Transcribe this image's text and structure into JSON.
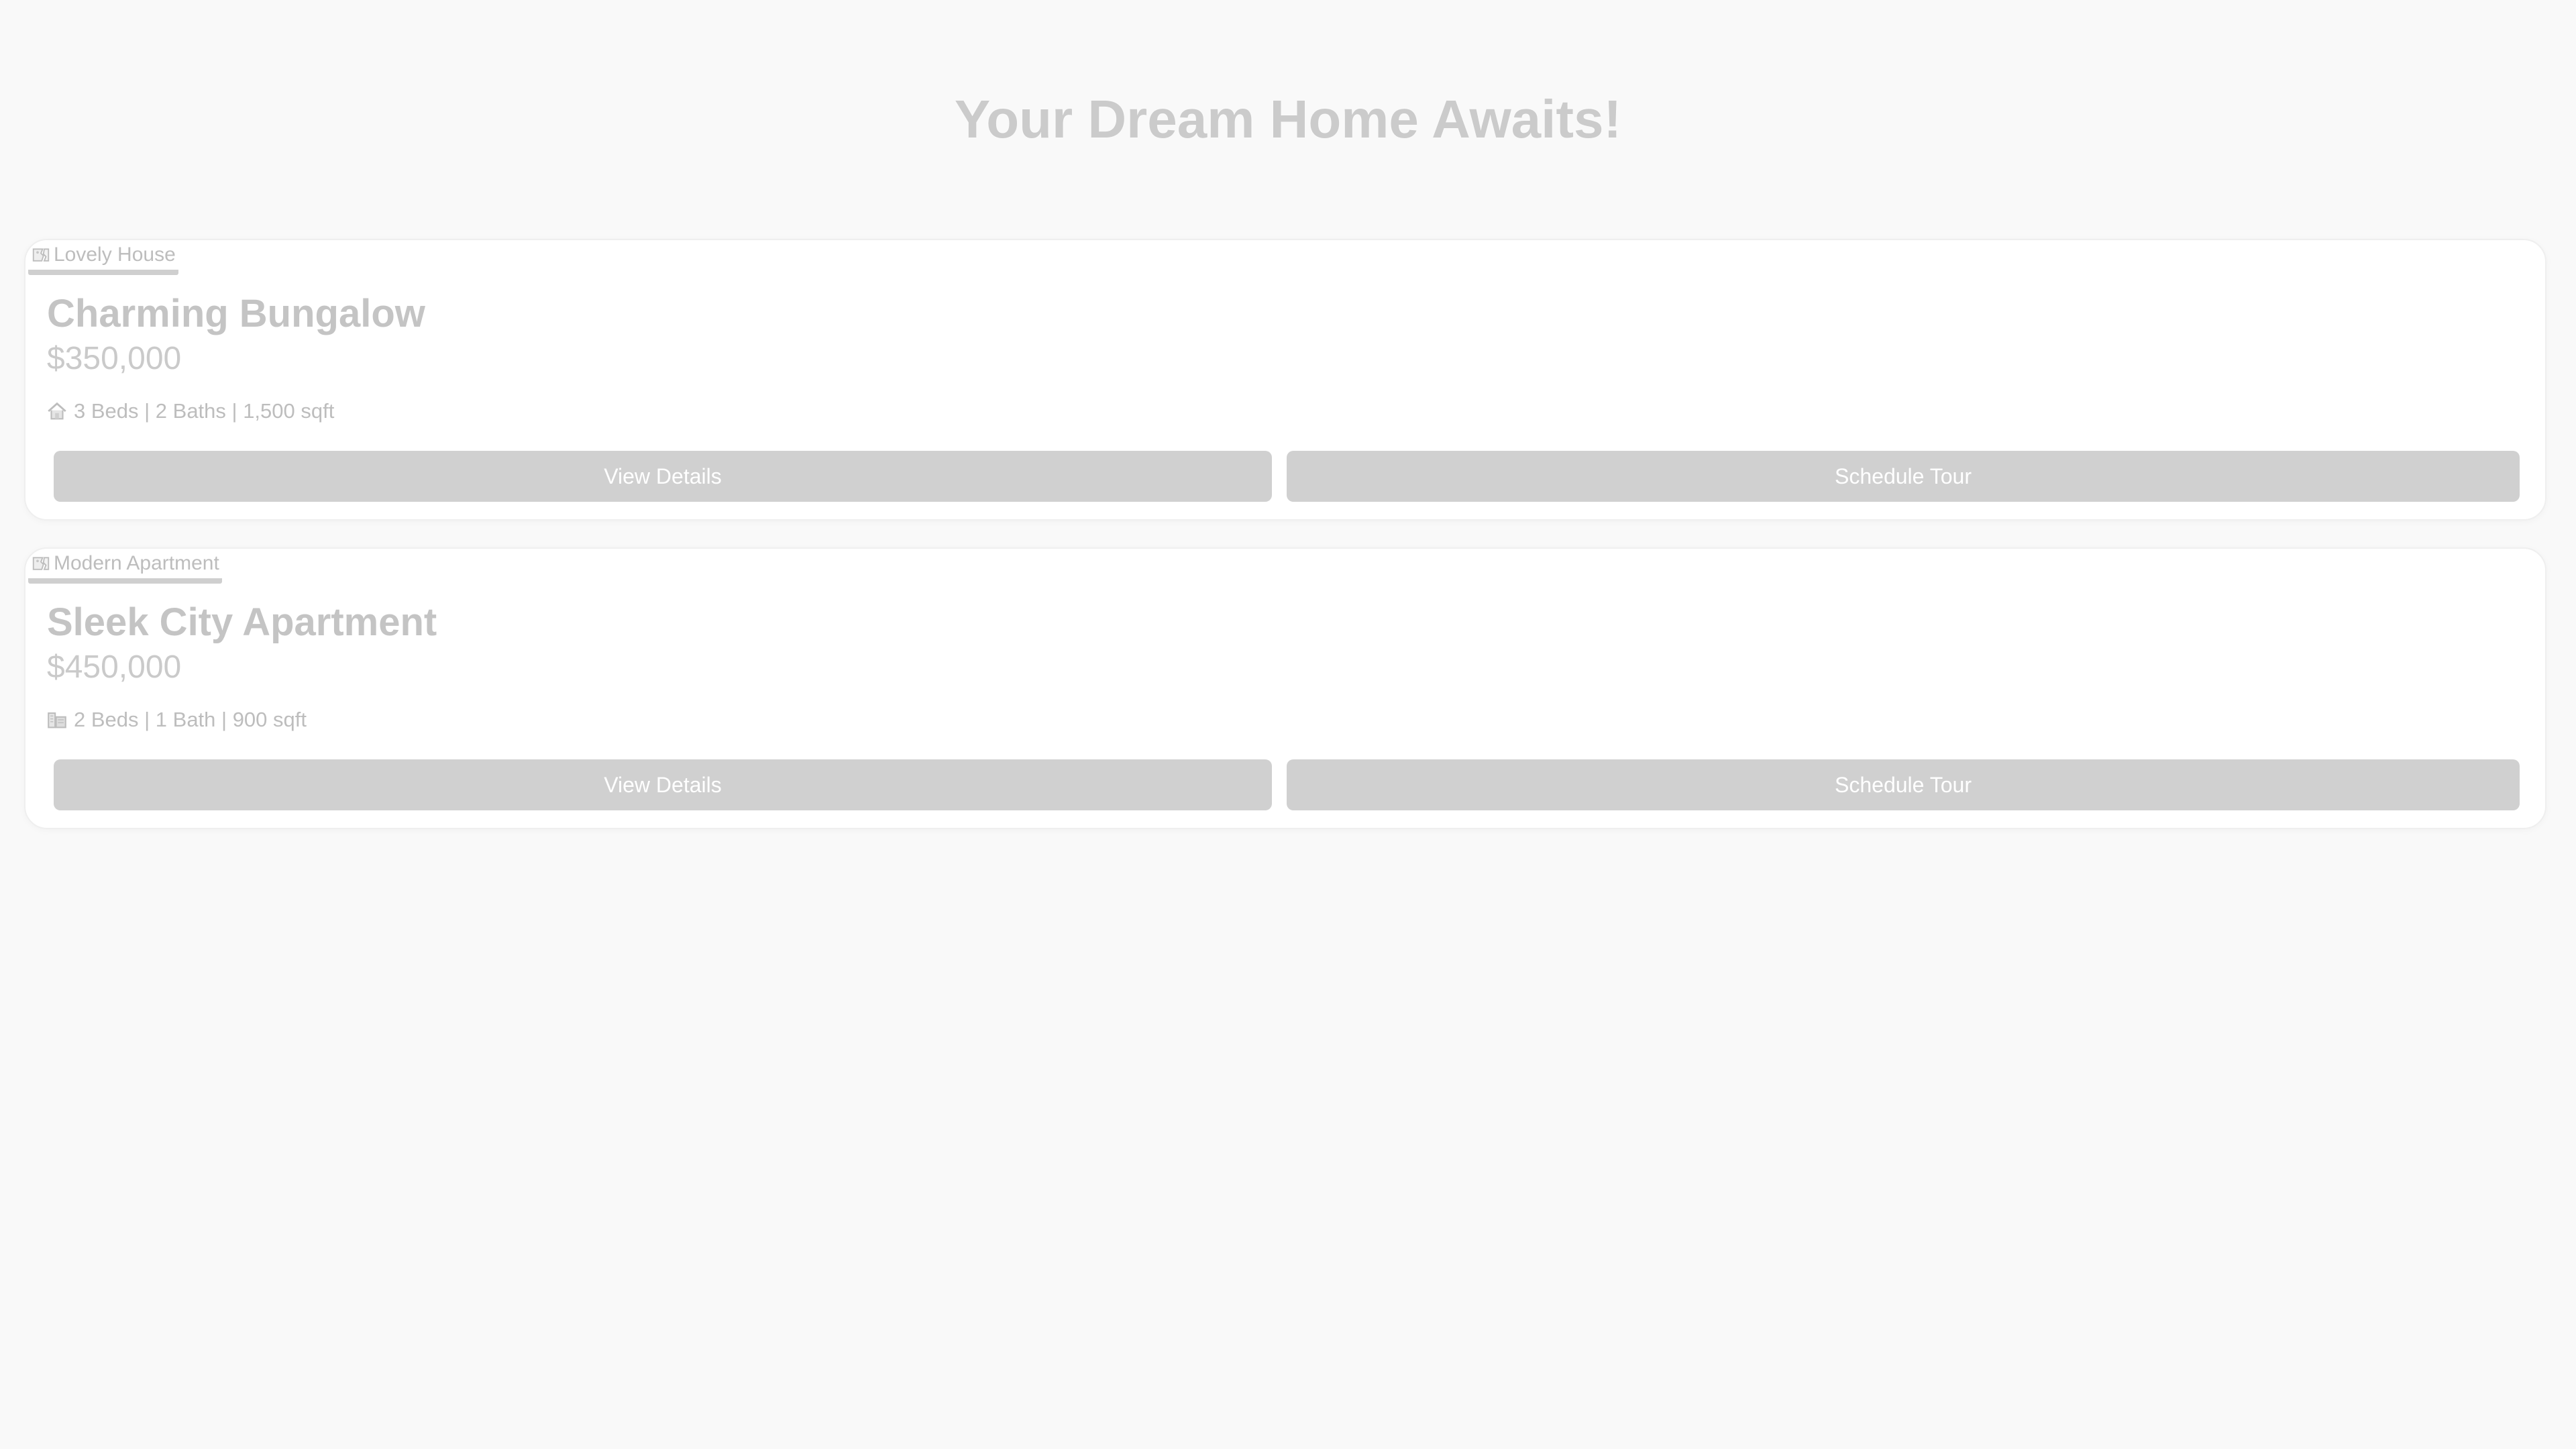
{
  "page": {
    "title": "Your Dream Home Awaits!"
  },
  "listings": [
    {
      "image_alt": "Lovely House",
      "title": "Charming Bungalow",
      "price": "$350,000",
      "specs": "3 Beds | 2 Baths | 1,500 sqft",
      "spec_icon": "house-icon",
      "buttons": {
        "view_details": "View Details",
        "schedule_tour": "Schedule Tour"
      }
    },
    {
      "image_alt": "Modern Apartment",
      "title": "Sleek City Apartment",
      "price": "$450,000",
      "specs": "2 Beds | 1 Bath | 900 sqft",
      "spec_icon": "building-icon",
      "buttons": {
        "view_details": "View Details",
        "schedule_tour": "Schedule Tour"
      }
    }
  ],
  "colors": {
    "page_background": "#f9f9f9",
    "card_background": "#ffffff",
    "button_background": "#d0d0d0",
    "button_text": "#ffffff",
    "muted_text": "#bdbdbd"
  }
}
